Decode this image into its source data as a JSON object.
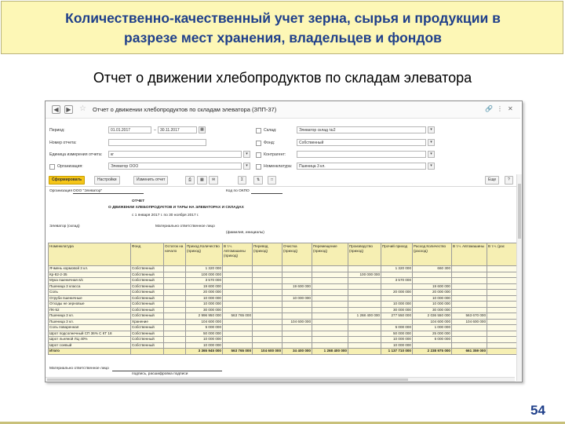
{
  "slide": {
    "title_line1": "Количественно-качественный учет зерна, сырья и продукции в",
    "title_line2": "разрезе мест хранения, владельцев и фондов",
    "subtitle": "Отчет о движении хлебопродуктов  по складам элеватора",
    "page_number": "54",
    "colors": {
      "banner_bg": "#fdf7b6",
      "title_text": "#1f3f8a",
      "primary_button": "#f5c518",
      "table_header": "#f6efb3"
    }
  },
  "window": {
    "title": "Отчет о движении хлебопродуктов по складам элеватора (ЗПП-37)",
    "nav_back_icon": "arrow-left-icon",
    "nav_forward_icon": "arrow-right-icon",
    "favorite_icon": "star-icon",
    "controls": [
      "link-icon",
      "more-icon",
      "close-icon"
    ]
  },
  "filters": {
    "period_label": "Период:",
    "period_from": "01.01.2017",
    "period_to": "30.11.2017",
    "report_number_label": "Номер отчета:",
    "unit_label": "Единица измерения отчета:",
    "unit_value": "кг",
    "organization_label": "Организация:",
    "organization_value": "Элеватор ООО",
    "warehouse_label": "Склад:",
    "warehouse_value": "Элеватор склад №2",
    "fund_label": "Фонд:",
    "fund_value": "Собственный",
    "counterparty_label": "Контрагент:",
    "nomenclature_label": "Номенклатура:",
    "nomenclature_value": "Пшеница 3 кл."
  },
  "toolbar": {
    "generate": "Сформировать",
    "settings": "Настройки",
    "change_variant": "Изменить отчет",
    "more": "Еще"
  },
  "report": {
    "org_label": "Организация",
    "org_value": "ООО \"Элеватор\"",
    "okpo_label": "Код по ОКПО",
    "title1": "ОТЧЕТ",
    "title2": "О ДВИЖЕНИИ ХЛЕБОПРОДУКТОВ И ТАРЫ НА ЭЛЕВАТОРАХ И СКЛАДАХ",
    "period_line": "с 1 января 2017 г. по 30 ноября 2017 г.",
    "storage_label": "Элеватор (склад)",
    "resp_line": "Материально ответственное лицо",
    "resp_sub": "(фамилия, инициалы)",
    "resp_footer": "Материально ответственное лицо",
    "sign_footer": "подпись, расшифровка подписи"
  },
  "table": {
    "headers": [
      "Номенклатура",
      "Фонд",
      "Остаток на начало",
      "Приход Количество (приход)",
      "В т.ч. Автомашины (приход)",
      "Перевод (приход)",
      "Очистка (приход)",
      "Перемещение (приход)",
      "Производство (приход)",
      "Прочий приход",
      "Расход Количество (расход)",
      "В т.ч. Автомашины",
      "В т.ч. (рас"
    ],
    "rows": [
      [
        "Ячмень кормовой 3 кл.",
        "Собственный",
        "",
        "1 320 000",
        "",
        "",
        "",
        "",
        "",
        "1 320 000",
        "660 300",
        "",
        ""
      ],
      [
        "Кр-82-2-35",
        "Собственный",
        "",
        "100 000 000",
        "",
        "",
        "",
        "",
        "100 000 000",
        "",
        "",
        "",
        ""
      ],
      [
        "Мука пшеничная в/с",
        "Собственный",
        "",
        "3 570 000",
        "",
        "",
        "",
        "",
        "",
        "3 570 000",
        "",
        "",
        ""
      ],
      [
        "Пшеница 3 класса",
        "Собственный",
        "",
        "19 600 000",
        "",
        "",
        "19 600 000",
        "",
        "",
        "",
        "19 600 000",
        "",
        ""
      ],
      [
        "Соль",
        "Собственный",
        "",
        "20 000 000",
        "",
        "",
        "",
        "",
        "",
        "20 000 000",
        "20 000 000",
        "",
        ""
      ],
      [
        "Отруби пшеничные",
        "Собственный",
        "",
        "10 000 000",
        "",
        "",
        "10 000 000",
        "",
        "",
        "",
        "10 000 000",
        "",
        ""
      ],
      [
        "Отходы не зерновые",
        "Собственный",
        "",
        "10 000 000",
        "",
        "",
        "",
        "",
        "",
        "10 000 000",
        "10 000 000",
        "",
        ""
      ],
      [
        "ПК-52",
        "Собственный",
        "",
        "30 000 000",
        "",
        "",
        "",
        "",
        "",
        "30 000 000",
        "30 000 000",
        "",
        ""
      ],
      [
        "Пшеница 3 кл.",
        "Собственный",
        "",
        "2 996 950 000",
        "563 765 000",
        "",
        "",
        "",
        "1 268 400 000",
        "277 550 000",
        "2 036 550 000",
        "563 670 000",
        ""
      ],
      [
        "Пшеница 3 кл.",
        "Хранение",
        "",
        "104 600 000",
        "",
        "",
        "104 600 000",
        "",
        "",
        "",
        "104 600 000",
        "104 600 000",
        ""
      ],
      [
        "Соль поваренная",
        "Собственный",
        "",
        "5 000 000",
        "",
        "",
        "",
        "",
        "",
        "5 000 000",
        "1 000 000",
        "",
        ""
      ],
      [
        "Шрот подсолнечный СП 36% С КТ 18",
        "Собственный",
        "",
        "50 000 000",
        "",
        "",
        "",
        "",
        "",
        "50 000 000",
        "25 000 000",
        "",
        ""
      ],
      [
        "Шрот льняной ЛЦ 40%",
        "Собственный",
        "",
        "10 000 000",
        "",
        "",
        "",
        "",
        "",
        "10 000 000",
        "6 000 000",
        "",
        ""
      ],
      [
        "Шрот соевый",
        "Собственный",
        "",
        "10 000 000",
        "",
        "",
        "",
        "",
        "",
        "10 000 000",
        "",
        "",
        ""
      ]
    ],
    "total": [
      "Итого",
      "",
      "",
      "3 365 945 000",
      "563 765 000",
      "104 600 000",
      "34 400 000",
      "1 268 400 000",
      "",
      "1 137 710 000",
      "2 238 975 000",
      "661 359 000",
      ""
    ]
  }
}
